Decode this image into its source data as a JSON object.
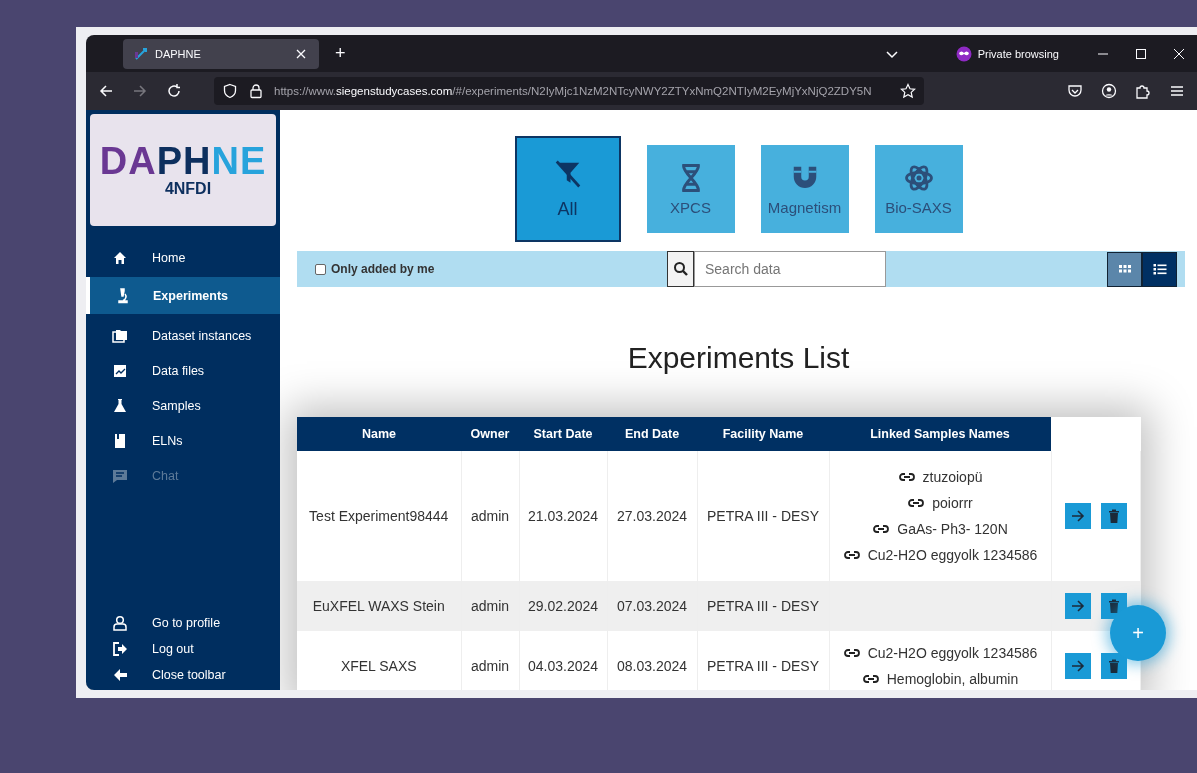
{
  "browser": {
    "tab_title": "DAPHNE",
    "new_tab": "+",
    "private_label": "Private browsing",
    "url": "https://www.**siegenstudycases.com**/#/experiments/N2IyMjc1NzM2NTcyNWY2ZTYxNmQ2NTIyM2EyMjYxNjQ2ZDY5N"
  },
  "logo": {
    "parts": [
      {
        "text": "DA",
        "color": "#6a3893"
      },
      {
        "text": "PH",
        "color": "#0d2f5e"
      },
      {
        "text": "NE",
        "color": "#27a3dc"
      }
    ],
    "subtitle": "4NFDI"
  },
  "sidebar": {
    "items": [
      {
        "label": "Home",
        "selected": false,
        "disabled": false
      },
      {
        "label": "Experiments",
        "selected": true,
        "disabled": false
      },
      {
        "label": "Dataset instances",
        "selected": false,
        "disabled": false
      },
      {
        "label": "Data files",
        "selected": false,
        "disabled": false
      },
      {
        "label": "Samples",
        "selected": false,
        "disabled": false
      },
      {
        "label": "ELNs",
        "selected": false,
        "disabled": false
      },
      {
        "label": "Chat",
        "selected": false,
        "disabled": true
      }
    ],
    "bottom_items": [
      "Go to profile",
      "Log out",
      "Close toolbar"
    ]
  },
  "categories": [
    {
      "label": "All",
      "selected": true
    },
    {
      "label": "XPCS",
      "selected": false
    },
    {
      "label": "Magnetism",
      "selected": false
    },
    {
      "label": "Bio-SAXS",
      "selected": false
    }
  ],
  "filter": {
    "checkbox_label": "Only added by me",
    "checked": false,
    "search_placeholder": "Search data",
    "views": [
      {
        "kind": "grid",
        "selected": false
      },
      {
        "kind": "list",
        "selected": true
      }
    ]
  },
  "heading": "Experiments List",
  "table": {
    "columns": [
      "Name",
      "Owner",
      "Start Date",
      "End Date",
      "Facility Name",
      "Linked Samples Names"
    ],
    "rows": [
      {
        "name": "Test Experiment98444",
        "owner": "admin",
        "start": "21.03.2024",
        "end": "27.03.2024",
        "facility": "PETRA III - DESY",
        "samples": [
          "ztuzoiopü",
          "poiorrr",
          "GaAs- Ph3- 120N",
          "Cu2-H2O eggyolk 1234586"
        ]
      },
      {
        "name": "EuXFEL WAXS Stein",
        "owner": "admin",
        "start": "29.02.2024",
        "end": "07.03.2024",
        "facility": "PETRA III - DESY",
        "samples": []
      },
      {
        "name": "XFEL SAXS",
        "owner": "admin",
        "start": "04.03.2024",
        "end": "08.03.2024",
        "facility": "PETRA III - DESY",
        "samples": [
          "Cu2-H2O eggyolk 1234586",
          "Hemoglobin, albumin"
        ]
      }
    ]
  },
  "fab": "+"
}
